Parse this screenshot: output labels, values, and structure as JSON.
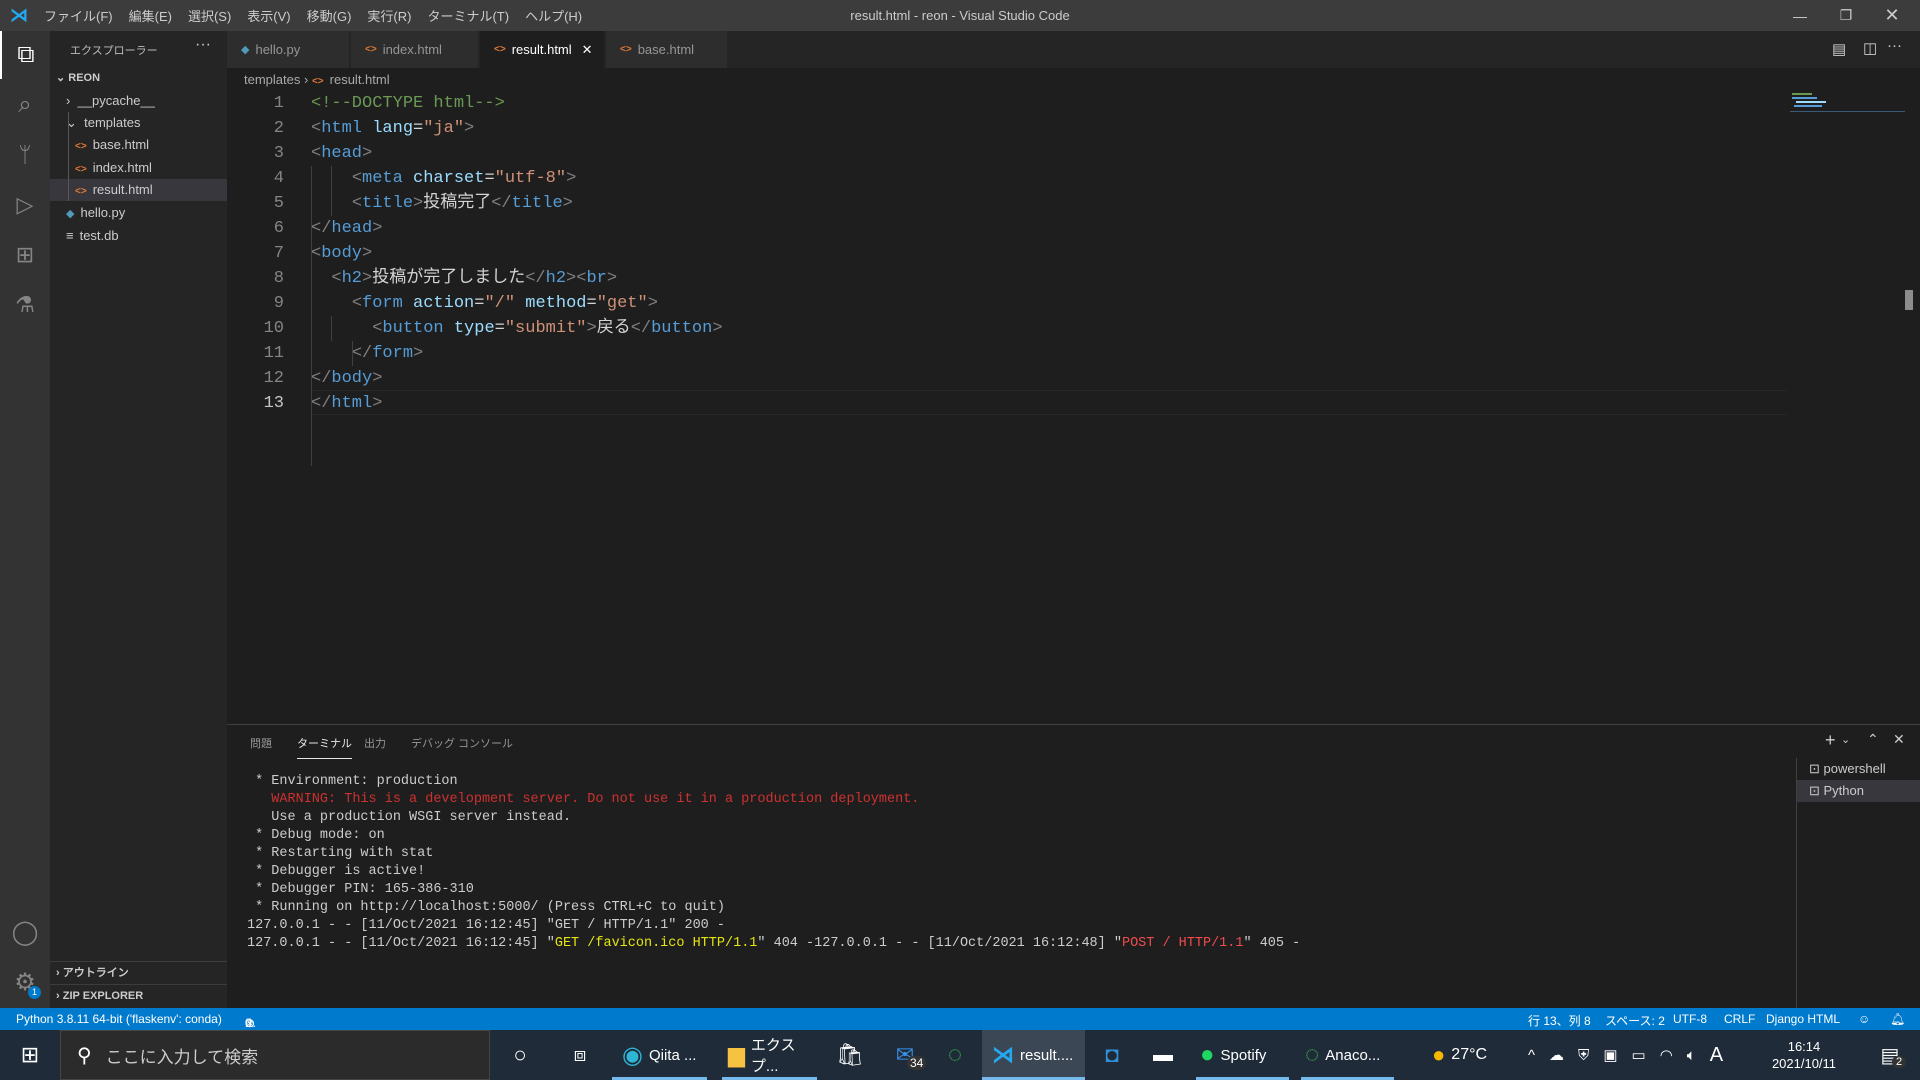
{
  "window": {
    "title": "result.html - reon - Visual Studio Code",
    "menu": [
      "ファイル(F)",
      "編集(E)",
      "選択(S)",
      "表示(V)",
      "移動(G)",
      "実行(R)",
      "ターミナル(T)",
      "ヘルプ(H)"
    ]
  },
  "sidebar": {
    "title": "エクスプローラー",
    "root": "REON",
    "items": [
      {
        "label": "__pycache__",
        "type": "folder-collapsed"
      },
      {
        "label": "templates",
        "type": "folder-open"
      },
      {
        "label": "base.html",
        "type": "html"
      },
      {
        "label": "index.html",
        "type": "html"
      },
      {
        "label": "result.html",
        "type": "html",
        "selected": true
      },
      {
        "label": "hello.py",
        "type": "python"
      },
      {
        "label": "test.db",
        "type": "file"
      }
    ],
    "outline": "アウトライン",
    "zip": "ZIP EXPLORER",
    "settings_badge": "1"
  },
  "tabs": [
    {
      "label": "hello.py",
      "icon": "python"
    },
    {
      "label": "index.html",
      "icon": "html"
    },
    {
      "label": "result.html",
      "icon": "html",
      "active": true
    },
    {
      "label": "base.html",
      "icon": "html"
    }
  ],
  "breadcrumb": [
    "templates",
    "result.html"
  ],
  "editor": {
    "current_line": 13,
    "lines": [
      "<!--DOCTYPE html-->",
      "<html lang=\"ja\">",
      "<head>",
      "    <meta charset=\"utf-8\">",
      "    <title>投稿完了</title>",
      "</head>",
      "<body>",
      "  <h2>投稿が完了しました</h2><br>",
      "    <form action=\"/\" method=\"get\">",
      "      <button type=\"submit\">戻る</button>",
      "    </form>",
      "</body>",
      "</html>"
    ]
  },
  "panel": {
    "tabs": [
      "問題",
      "ターミナル",
      "出力",
      "デバッグ コンソール"
    ],
    "active_tab": "ターミナル",
    "terminal": [
      {
        "text": " * Environment: production"
      },
      {
        "text": "   WARNING: This is a development server. Do not use it in a production deployment.",
        "color": "red"
      },
      {
        "text": "   Use a production WSGI server instead."
      },
      {
        "text": " * Debug mode: on"
      },
      {
        "text": " * Restarting with stat"
      },
      {
        "text": " * Debugger is active!"
      },
      {
        "text": " * Debugger PIN: 165-386-310"
      },
      {
        "text": " * Running on http://localhost:5000/ (Press CTRL+C to quit)"
      },
      {
        "text": "127.0.0.1 - - [11/Oct/2021 16:12:45] \"GET / HTTP/1.1\" 200 -"
      },
      {
        "parts": [
          "127.0.0.1 - - [11/Oct/2021 16:12:45] \"",
          "GET /favicon.ico HTTP/1.1",
          "\" 404 -127.0.0.1 - - [11/Oct/2021 16:12:48] \"",
          "POST / HTTP/1.1",
          "\" 405 -"
        ]
      }
    ],
    "terminals": [
      "powershell",
      "Python"
    ],
    "selected_terminal": "Python"
  },
  "statusbar": {
    "python": "Python 3.8.11 64-bit ('flaskenv': conda)",
    "errors": "0",
    "warnings": "0",
    "position": "行 13、列 8",
    "spaces": "スペース: 2",
    "encoding": "UTF-8",
    "eol": "CRLF",
    "language": "Django HTML"
  },
  "taskbar": {
    "search_placeholder": "ここに入力して検索",
    "apps": [
      {
        "label": "Qiita ..."
      },
      {
        "label": "エクスプ..."
      },
      {
        "label": "result...."
      },
      {
        "label": "Spotify"
      },
      {
        "label": "Anaco..."
      }
    ],
    "mail_badge": "34",
    "weather": "27°C",
    "ime": "A",
    "time": "16:14",
    "date": "2021/10/11",
    "notifications": "2"
  }
}
